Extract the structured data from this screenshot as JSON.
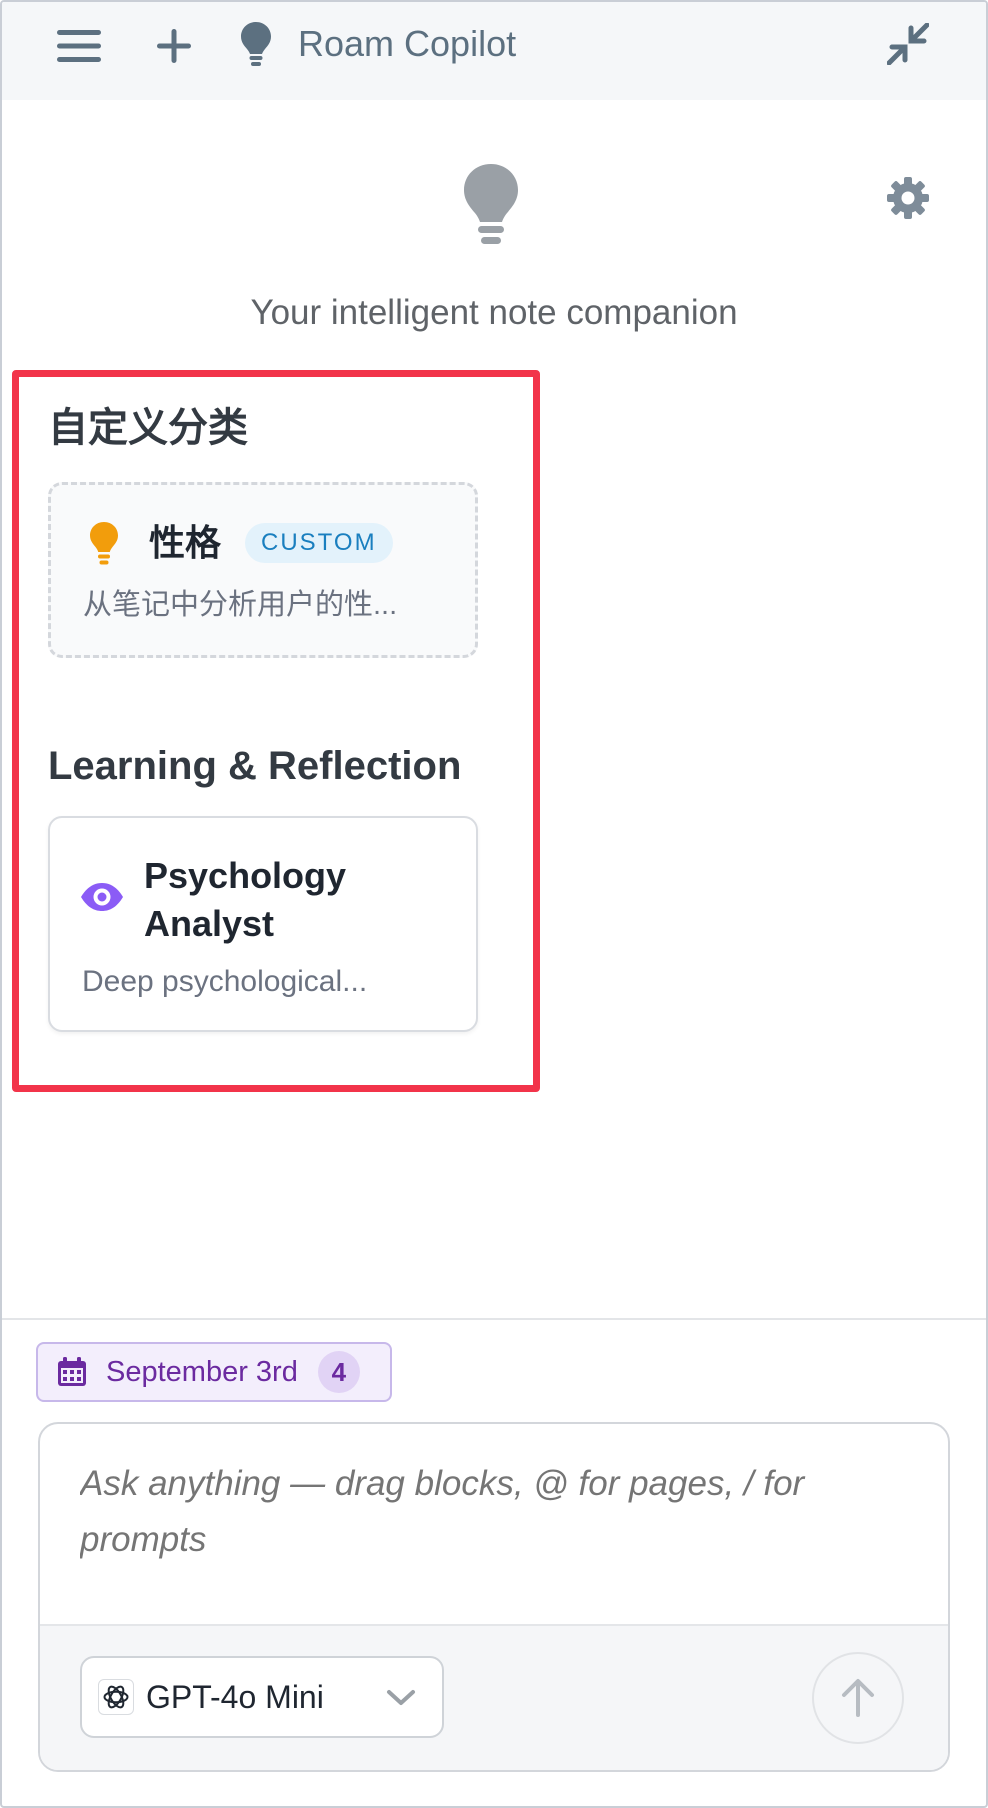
{
  "header": {
    "title": "Roam Copilot",
    "menu_icon": "hamburger-menu-icon",
    "new_chat_icon": "plus-icon",
    "logo_icon": "lightbulb-icon",
    "collapse_icon": "minimize-arrows-icon"
  },
  "hero": {
    "icon": "lightbulb-icon",
    "tagline": "Your intelligent note companion",
    "settings_icon": "gear-icon"
  },
  "sections": [
    {
      "title": "自定义分类",
      "cards": [
        {
          "icon": "lightbulb-icon",
          "icon_color": "#f29d0c",
          "title": "性格",
          "badge": "CUSTOM",
          "description": "从笔记中分析用户的性..."
        }
      ]
    },
    {
      "title": "Learning & Reflection",
      "cards": [
        {
          "icon": "eye-icon",
          "icon_color": "#8b5cf6",
          "title_line1": "Psychology",
          "title_line2": "Analyst",
          "description": "Deep psychological..."
        }
      ]
    }
  ],
  "composer": {
    "date_chip": {
      "icon": "calendar-icon",
      "label": "September 3rd",
      "count": "4"
    },
    "placeholder": "Ask anything — drag blocks, @ for pages, / for prompts",
    "model": {
      "icon": "openai-icon",
      "label": "GPT-4o Mini",
      "chevron_icon": "chevron-down-icon"
    },
    "send_icon": "arrow-up-icon"
  },
  "colors": {
    "header_bg": "#f5f7f9",
    "header_icon": "#5c7080",
    "highlight": "#f2344a",
    "custom_badge_bg": "#e3f2fb",
    "custom_badge_text": "#1a7fbf",
    "date_chip_text": "#6b2aa0"
  }
}
